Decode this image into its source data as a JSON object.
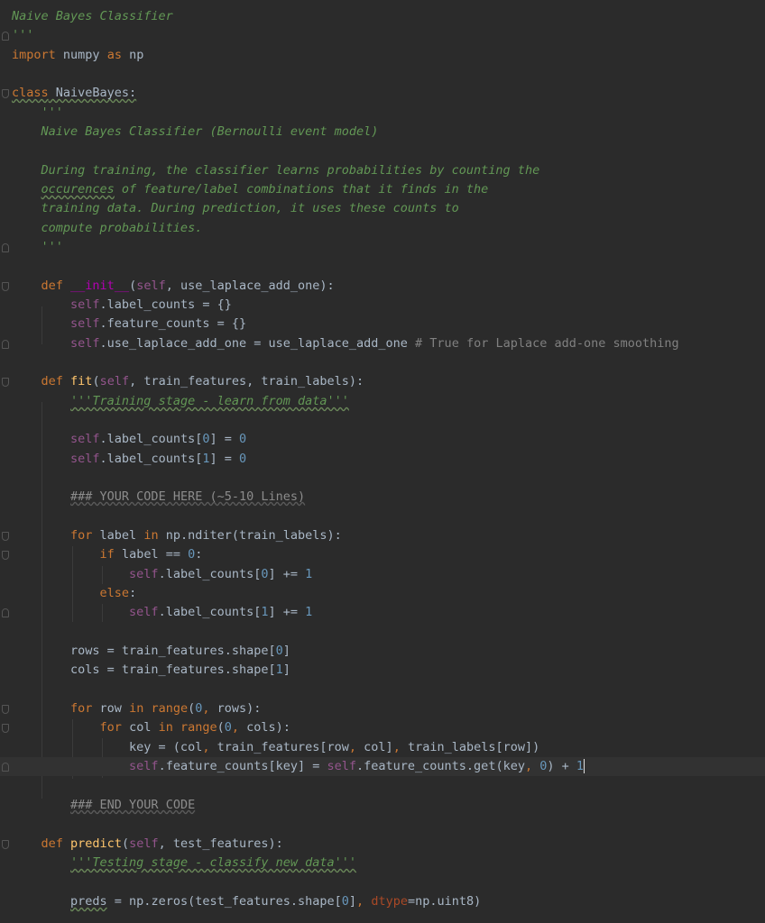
{
  "editor": {
    "language": "python",
    "colors": {
      "background": "#2b2b2b",
      "text": "#a9b7c6",
      "keyword": "#cc7832",
      "docstring": "#629755",
      "self": "#94558d",
      "number": "#6897bb",
      "function": "#ffc66d",
      "comment": "#808080"
    },
    "tokens": {
      "l0": "Naive Bayes Classifier",
      "l1": "'''",
      "l2a": "import",
      "l2b": " numpy ",
      "l2c": "as",
      "l2d": " np",
      "l4a": "class",
      "l4b": " NaiveBayes:",
      "l5": "    '''",
      "l6": "    Naive Bayes Classifier (Bernoulli event model)",
      "l8": "    During training, the classifier learns probabilities by counting the",
      "l9a": "    ",
      "l9b": "occurences",
      "l9c": " of feature/label combinations that it finds in the",
      "l10": "    training data. During prediction, it uses these counts to",
      "l11": "    compute probabilities.",
      "l12": "    '''",
      "l14a": "    ",
      "l14b": "def",
      "l14c": " ",
      "l14d": "__init__",
      "l14e": "(",
      "l14f": "self",
      "l14g": ", use_laplace_add_one):",
      "l15a": "        ",
      "l15b": "self",
      "l15c": ".label_counts = {}",
      "l16a": "        ",
      "l16b": "self",
      "l16c": ".feature_counts = {}",
      "l17a": "        ",
      "l17b": "self",
      "l17c": ".use_laplace_add_one = use_laplace_add_one",
      "l17d": " # True for Laplace add-one smoothing",
      "l19a": "    ",
      "l19b": "def",
      "l19c": " ",
      "l19d": "fit",
      "l19e": "(",
      "l19f": "self",
      "l19g": ", train_features, train_labels):",
      "l20a": "        ",
      "l20b": "'''Training stage - learn from data'''",
      "l22a": "        ",
      "l22b": "self",
      "l22c": ".label_counts[",
      "l22d": "0",
      "l22e": "] = ",
      "l22f": "0",
      "l23a": "        ",
      "l23b": "self",
      "l23c": ".label_counts[",
      "l23d": "1",
      "l23e": "] = ",
      "l23f": "0",
      "l25a": "        ",
      "l25b": "### YOUR CODE HERE (~5-10 Lines)",
      "l27a": "        ",
      "l27b": "for",
      "l27c": " label ",
      "l27d": "in",
      "l27e": " np.nditer(train_labels):",
      "l28a": "            ",
      "l28b": "if",
      "l28c": " label == ",
      "l28d": "0",
      "l28e": ":",
      "l29a": "                ",
      "l29b": "self",
      "l29c": ".label_counts[",
      "l29d": "0",
      "l29e": "] += ",
      "l29f": "1",
      "l30a": "            ",
      "l30b": "else",
      "l30c": ":",
      "l31a": "                ",
      "l31b": "self",
      "l31c": ".label_counts[",
      "l31d": "1",
      "l31e": "] += ",
      "l31f": "1",
      "l33a": "        rows = train_features.shape[",
      "l33b": "0",
      "l33c": "]",
      "l34a": "        cols = train_features.shape[",
      "l34b": "1",
      "l34c": "]",
      "l36a": "        ",
      "l36b": "for",
      "l36c": " row ",
      "l36d": "in",
      "l36e": " ",
      "l36f": "range",
      "l36g": "(",
      "l36h": "0",
      "l36i": ",",
      "l36j": " rows):",
      "l37a": "            ",
      "l37b": "for",
      "l37c": " col ",
      "l37d": "in",
      "l37e": " ",
      "l37f": "range",
      "l37g": "(",
      "l37h": "0",
      "l37i": ",",
      "l37j": " cols):",
      "l38a": "                key = (col",
      "l38b": ",",
      "l38c": " train_features[row",
      "l38d": ",",
      "l38e": " col]",
      "l38f": ",",
      "l38g": " train_labels[row])",
      "l39a": "                ",
      "l39b": "self",
      "l39c": ".feature_counts[key] = ",
      "l39d": "self",
      "l39e": ".feature_counts.get(key",
      "l39f": ",",
      "l39g": " ",
      "l39h": "0",
      "l39i": ") + ",
      "l39j": "1",
      "l41a": "        ",
      "l41b": "### END YOUR CODE",
      "l43a": "    ",
      "l43b": "def",
      "l43c": " ",
      "l43d": "predict",
      "l43e": "(",
      "l43f": "self",
      "l43g": ", test_features):",
      "l44a": "        ",
      "l44b": "'''Testing stage - classify new data'''",
      "l46a": "        ",
      "l46b": "preds",
      "l46c": " = np.zeros(test_features.shape[",
      "l46d": "0",
      "l46e": "]",
      "l46f": ",",
      "l46g": " ",
      "l46h": "dtype",
      "l46i": "=np.uint8)"
    }
  }
}
